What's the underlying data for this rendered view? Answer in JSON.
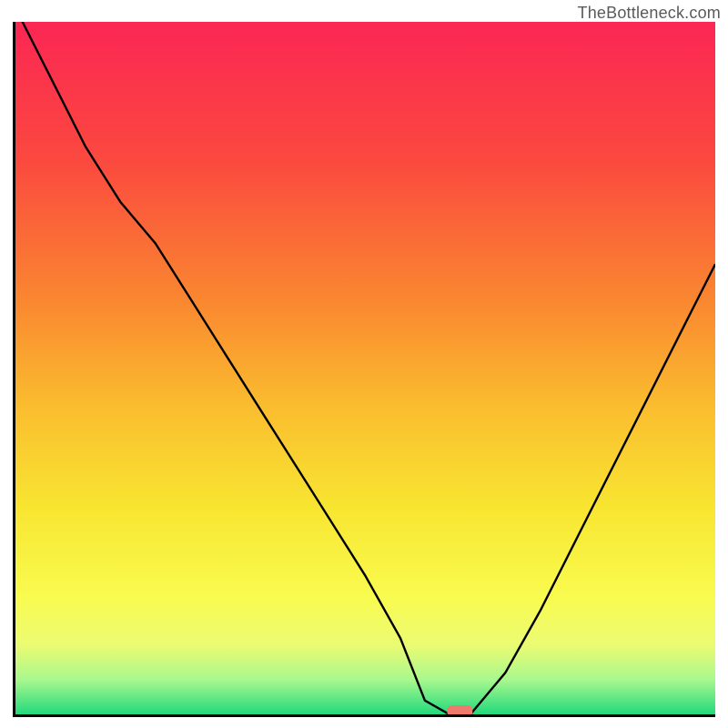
{
  "watermark": "TheBottleneck.com",
  "chart_data": {
    "type": "line",
    "title": "",
    "xlabel": "",
    "ylabel": "",
    "xlim": [
      0,
      100
    ],
    "ylim": [
      0,
      100
    ],
    "x": [
      0,
      5,
      10,
      15,
      20,
      25,
      30,
      35,
      40,
      45,
      50,
      55,
      58.5,
      62,
      65,
      70,
      75,
      80,
      85,
      90,
      95,
      100
    ],
    "y": [
      102,
      92,
      82,
      74,
      68,
      60,
      52,
      44,
      36,
      28,
      20,
      11,
      2,
      0,
      0,
      6,
      15,
      25,
      35,
      45,
      55,
      65
    ],
    "marker": {
      "x": 63.5,
      "y": 0,
      "color": "#f0796e"
    },
    "gradient_stops": [
      {
        "offset": 0,
        "color": "#fb2654"
      },
      {
        "offset": 0.2,
        "color": "#fb493f"
      },
      {
        "offset": 0.4,
        "color": "#fa8630"
      },
      {
        "offset": 0.55,
        "color": "#fabb2f"
      },
      {
        "offset": 0.7,
        "color": "#f8e530"
      },
      {
        "offset": 0.83,
        "color": "#f9fb4f"
      },
      {
        "offset": 0.9,
        "color": "#ebfb72"
      },
      {
        "offset": 0.95,
        "color": "#a9f88e"
      },
      {
        "offset": 1.0,
        "color": "#22d97c"
      }
    ]
  }
}
